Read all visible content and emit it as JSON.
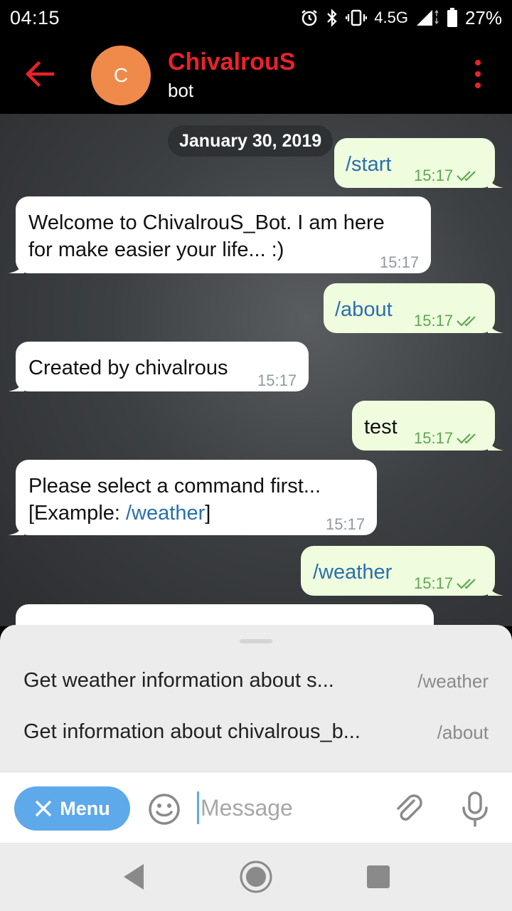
{
  "status_bar": {
    "time": "04:15",
    "network": "4.5G",
    "battery": "27%"
  },
  "header": {
    "avatar_letter": "C",
    "avatar_color": "#f08a4b",
    "title": "ChivalrouS",
    "subtitle": "bot",
    "accent_color": "#e8232b"
  },
  "chat": {
    "date": "January 30, 2019",
    "messages": [
      {
        "dir": "out",
        "text": "/start",
        "time": "15:17"
      },
      {
        "dir": "in",
        "line1": "Welcome to ChivalrouS_Bot. I am here",
        "line2": "for make easier your life... :)",
        "time": "15:17"
      },
      {
        "dir": "out",
        "text": "/about",
        "time": "15:17"
      },
      {
        "dir": "in",
        "text": "Created by chivalrous",
        "time": "15:17"
      },
      {
        "dir": "out",
        "text": "test",
        "time": "15:17"
      },
      {
        "dir": "in",
        "line1": "Please select a command first...",
        "line2_prefix": "[Example: ",
        "line2_cmd": "/weather",
        "line2_suffix": "]",
        "time": "15:17"
      },
      {
        "dir": "out",
        "text": "/weather",
        "time": "15:17"
      }
    ]
  },
  "commands": [
    {
      "description": "Get weather information about s...",
      "command": "/weather"
    },
    {
      "description": "Get information about chivalrous_b...",
      "command": "/about"
    }
  ],
  "input": {
    "menu_label": "Menu",
    "placeholder": "Message"
  }
}
